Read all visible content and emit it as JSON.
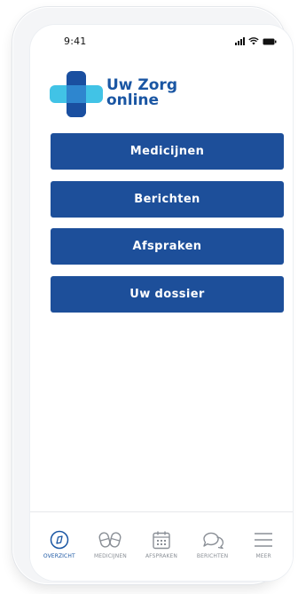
{
  "status_bar": {
    "time": "9:41"
  },
  "brand": {
    "line1": "Uw Zorg",
    "line2": "online",
    "colors": {
      "primary": "#1d4f9a",
      "cross_dark": "#1a4fa0",
      "cross_light": "#41c3e6"
    }
  },
  "menu": {
    "buttons": [
      {
        "label": "Medicijnen"
      },
      {
        "label": "Berichten"
      },
      {
        "label": "Afspraken"
      },
      {
        "label": "Uw dossier"
      }
    ]
  },
  "tab_bar": {
    "active_index": 0,
    "tabs": [
      {
        "label": "OVERZICHT",
        "icon": "overview-icon"
      },
      {
        "label": "MEDICIJNEN",
        "icon": "pills-icon"
      },
      {
        "label": "AFSPRAKEN",
        "icon": "calendar-icon"
      },
      {
        "label": "BERICHTEN",
        "icon": "chat-bubbles-icon"
      },
      {
        "label": "MEER",
        "icon": "menu-icon"
      }
    ]
  }
}
